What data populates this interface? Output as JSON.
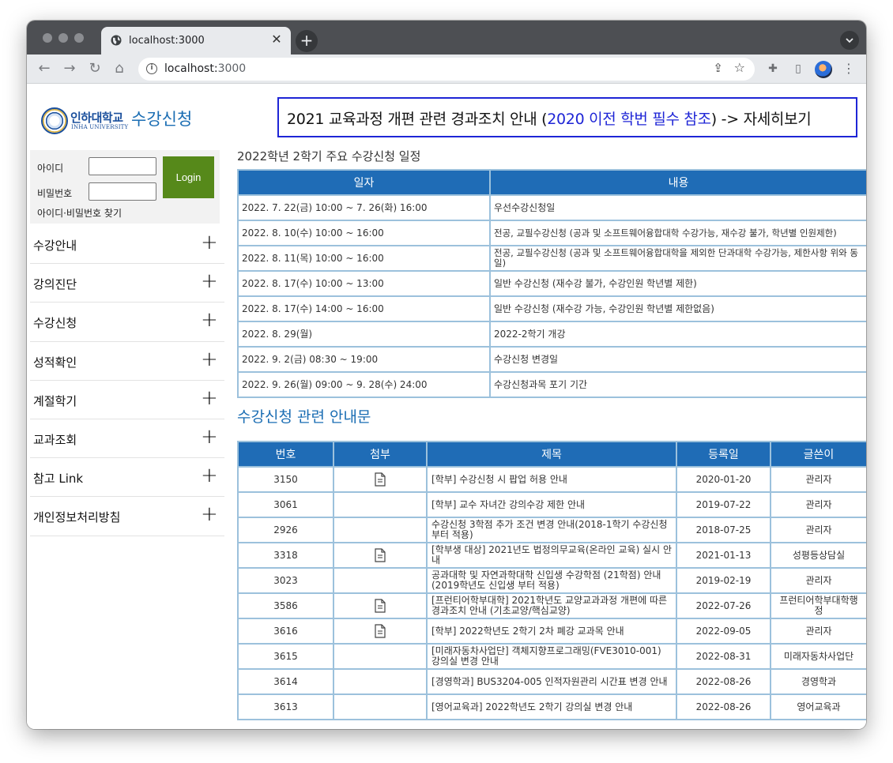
{
  "browser": {
    "tab_title": "localhost:3000",
    "new_tab_symbol": "+",
    "close_symbol": "✕",
    "url_host": "localhost:",
    "url_port": "3000"
  },
  "site": {
    "logo_korean": "인하대학교",
    "logo_english": "INHA UNIVERSITY",
    "title": "수강신청"
  },
  "login": {
    "id_label": "아이디",
    "pw_label": "비밀번호",
    "button": "Login",
    "find_link": "아이디·비밀번호 찾기"
  },
  "sidebar": {
    "items": [
      {
        "label": "수강안내"
      },
      {
        "label": "강의진단"
      },
      {
        "label": "수강신청"
      },
      {
        "label": "성적확인"
      },
      {
        "label": "계절학기"
      },
      {
        "label": "교과조회"
      },
      {
        "label": "참고 Link"
      },
      {
        "label": "개인정보처리방침"
      }
    ],
    "expand_symbol": "+"
  },
  "notice": {
    "prefix": "2021 교육과정 개편 관련 경과조치 안내 (",
    "highlight": "2020 이전 학번 필수 참조",
    "suffix": ") -> 자세히보기"
  },
  "schedule": {
    "title": "2022학년 2학기 주요 수강신청 일정",
    "headers": [
      "일자",
      "내용"
    ],
    "rows": [
      {
        "date": "2022. 7. 22(금) 10:00 ~ 7. 26(화) 16:00",
        "content": "우선수강신청일"
      },
      {
        "date": "2022. 8. 10(수) 10:00 ~ 16:00",
        "content": "전공, 교필수강신청 (공과 및 소프트웨어융합대학 수강가능, 재수강 불가, 학년별 인원제한)"
      },
      {
        "date": "2022. 8. 11(목) 10:00 ~ 16:00",
        "content": "전공, 교필수강신청 (공과 및 소프트웨어융합대학을 제외한 단과대학 수강가능, 제한사항 위와 동일)"
      },
      {
        "date": "2022. 8. 17(수) 10:00 ~ 13:00",
        "content": "일반 수강신청 (재수강 불가, 수강인원 학년별 제한)"
      },
      {
        "date": "2022. 8. 17(수) 14:00 ~ 16:00",
        "content": "일반 수강신청 (재수강 가능, 수강인원 학년별 제한없음)"
      },
      {
        "date": "2022. 8. 29(월)",
        "content": "2022-2학기 개강"
      },
      {
        "date": "2022. 9. 2(금) 08:30 ~ 19:00",
        "content": "수강신청 변경일"
      },
      {
        "date": "2022. 9. 26(월) 09:00 ~ 9. 28(수) 24:00",
        "content": "수강신청과목 포기 기간"
      }
    ]
  },
  "guides": {
    "title": "수강신청 관련 안내문",
    "headers": [
      "번호",
      "첨부",
      "제목",
      "등록일",
      "글쓴이"
    ],
    "rows": [
      {
        "no": "3150",
        "attach": true,
        "title": "[학부] 수강신청 시 팝업 허용 안내",
        "date": "2020-01-20",
        "author": "관리자"
      },
      {
        "no": "3061",
        "attach": false,
        "title": "[학부] 교수 자녀간 강의수강 제한 안내",
        "date": "2019-07-22",
        "author": "관리자"
      },
      {
        "no": "2926",
        "attach": false,
        "title": "수강신청 3학점 추가 조건 변경 안내(2018-1학기 수강신청부터 적용)",
        "date": "2018-07-25",
        "author": "관리자"
      },
      {
        "no": "3318",
        "attach": true,
        "title": "[학부생 대상] 2021년도 법정의무교육(온라인 교육) 실시 안내",
        "date": "2021-01-13",
        "author": "성평등상담실"
      },
      {
        "no": "3023",
        "attach": false,
        "title": "공과대학 및 자연과학대학 신입생 수강학점 (21학점) 안내(2019학년도 신입생 부터 적용)",
        "date": "2019-02-19",
        "author": "관리자"
      },
      {
        "no": "3586",
        "attach": true,
        "title": "[프런티어학부대학] 2021학년도 교양교과과정 개편에 따른 경과조치 안내 (기초교양/핵심교양)",
        "date": "2022-07-26",
        "author": "프런티어학부대학행정"
      },
      {
        "no": "3616",
        "attach": true,
        "title": "[학부] 2022학년도 2학기 2차 폐강 교과목 안내",
        "date": "2022-09-05",
        "author": "관리자"
      },
      {
        "no": "3615",
        "attach": false,
        "title": "[미래자동차사업단] 객체지향프로그래밍(FVE3010-001) 강의실 변경 안내",
        "date": "2022-08-31",
        "author": "미래자동차사업단"
      },
      {
        "no": "3614",
        "attach": false,
        "title": "[경영학과] BUS3204-005 인적자원관리 시간표 변경 안내",
        "date": "2022-08-26",
        "author": "경영학과"
      },
      {
        "no": "3613",
        "attach": false,
        "title": "[영어교육과] 2022학년도 2학기 강의실 변경 안내",
        "date": "2022-08-26",
        "author": "영어교육과"
      }
    ]
  },
  "colors": {
    "header_blue": "#1f6cb6",
    "login_green": "#56891a",
    "banner_border": "#1e25d6",
    "title_blue": "#1a6db3"
  }
}
